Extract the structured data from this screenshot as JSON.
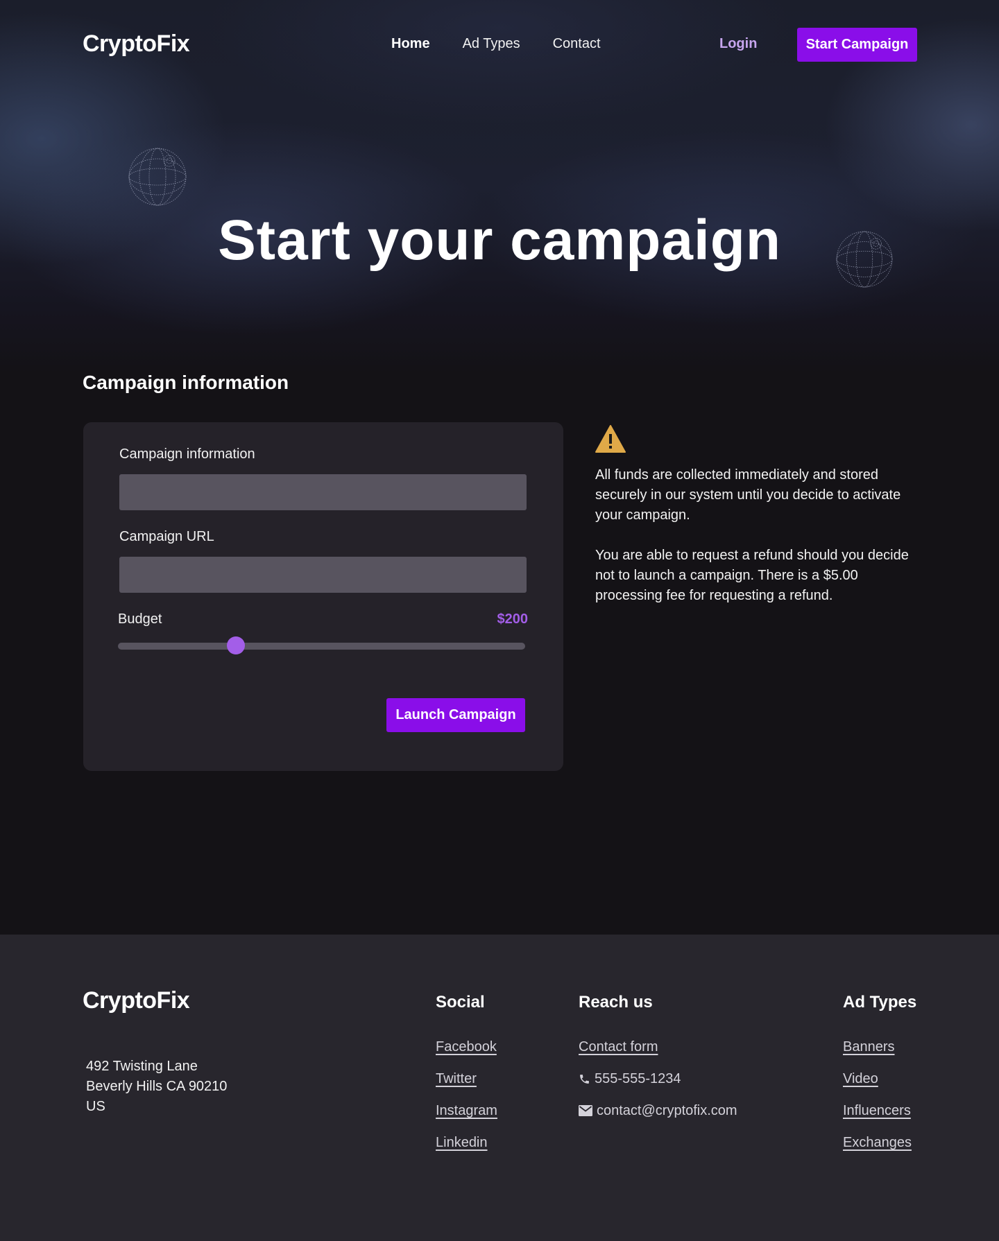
{
  "brand": {
    "name": "CryptoFix"
  },
  "nav": {
    "links": [
      {
        "label": "Home",
        "active": true
      },
      {
        "label": "Ad Types",
        "active": false
      },
      {
        "label": "Contact",
        "active": false
      }
    ],
    "login_label": "Login",
    "cta_label": "Start Campaign"
  },
  "hero": {
    "title": "Start your campaign"
  },
  "section": {
    "title": "Campaign information"
  },
  "form": {
    "campaign_info_label": "Campaign information",
    "campaign_info_value": "",
    "campaign_url_label": "Campaign URL",
    "campaign_url_value": "",
    "budget_label": "Budget",
    "budget_value": "$200",
    "budget_slider_fraction": 0.29,
    "submit_label": "Launch Campaign"
  },
  "notice": {
    "icon": "warning-icon",
    "paragraphs": [
      "All funds are collected immediately and stored securely in our system until you decide to activate your campaign.",
      "You are able to request a refund should you decide not to launch a campaign. There is a $5.00 processing fee for requesting a refund."
    ]
  },
  "footer": {
    "address_lines": [
      "492 Twisting Lane",
      "Beverly Hills CA 90210",
      "US"
    ],
    "social": {
      "title": "Social",
      "links": [
        "Facebook",
        "Twitter",
        "Instagram",
        "Linkedin"
      ]
    },
    "reach": {
      "title": "Reach us",
      "contact_form": "Contact form",
      "phone": "555-555-1234",
      "email": "contact@cryptofix.com"
    },
    "ad_types": {
      "title": "Ad Types",
      "links": [
        "Banners",
        "Video",
        "Influencers",
        "Exchanges"
      ]
    }
  },
  "colors": {
    "accent": "#8a0ee9",
    "accent_light": "#a35ee8",
    "warning": "#e0a948",
    "background": "#141216",
    "card": "#252229",
    "footer": "#28262d"
  }
}
